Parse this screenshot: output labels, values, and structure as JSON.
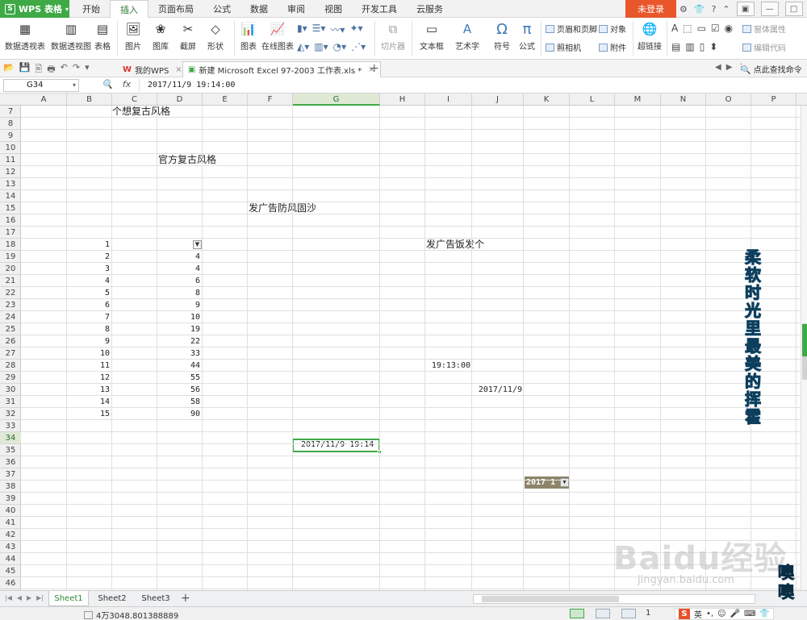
{
  "app": {
    "name": "WPS 表格",
    "login": "未登录"
  },
  "menu_tabs": [
    "开始",
    "插入",
    "页面布局",
    "公式",
    "数据",
    "审阅",
    "视图",
    "开发工具",
    "云服务"
  ],
  "active_menu_tab": "插入",
  "ribbon": {
    "pivot_table": "数据透视表",
    "pivot_chart": "数据透视图",
    "table": "表格",
    "picture": "图片",
    "gallery": "图库",
    "screenshot": "截屏",
    "shapes": "形状",
    "chart": "图表",
    "online_chart": "在线图表",
    "slicer": "切片器",
    "textbox": "文本框",
    "wordart": "艺术字",
    "symbol": "符号",
    "formula": "公式",
    "header_footer": "页眉和页脚",
    "object": "对象",
    "camera": "照相机",
    "attachment": "附件",
    "hyperlink": "超链接",
    "form_props": "窗体属性",
    "edit_code": "编辑代码"
  },
  "doc_tabs": [
    {
      "label": "我的WPS"
    },
    {
      "label": "新建 Microsoft Excel 97-2003 工作表.xls *"
    }
  ],
  "find_command": "点此查找命令",
  "name_box": "G34",
  "formula_bar": "2017/11/9  19:14:00",
  "columns": [
    "A",
    "B",
    "C",
    "D",
    "E",
    "F",
    "G",
    "H",
    "I",
    "J",
    "K",
    "L",
    "M",
    "N",
    "O",
    "P"
  ],
  "selected_column": "G",
  "rows": [
    "7",
    "8",
    "9",
    "10",
    "11",
    "12",
    "13",
    "14",
    "15",
    "16",
    "17",
    "18",
    "19",
    "20",
    "21",
    "22",
    "23",
    "24",
    "25",
    "26",
    "27",
    "28",
    "29",
    "30",
    "31",
    "32",
    "33",
    "34",
    "35",
    "36",
    "37",
    "38",
    "39",
    "40",
    "41",
    "42",
    "43",
    "44",
    "45",
    "46",
    "47"
  ],
  "selected_row": "34",
  "cells": {
    "c7": "个想复古风格",
    "d11": "官方复古风格",
    "f15": "发广告防风固沙",
    "i18": "发广告饭发个",
    "i28": "19:13:00",
    "j30": "2017/11/9",
    "g34": "2017/11/9 19:14",
    "k37": "2017 1",
    "b_values": [
      "1",
      "2",
      "3",
      "4",
      "5",
      "6",
      "7",
      "8",
      "9",
      "10",
      "11",
      "12",
      "13",
      "14",
      "15"
    ],
    "d_values": [
      "4",
      "4",
      "6",
      "8",
      "9",
      "10",
      "19",
      "22",
      "33",
      "44",
      "55",
      "56",
      "58",
      "90"
    ]
  },
  "vertical_art_text": "柔软时光里最美的挥霍",
  "sheets": [
    "Sheet1",
    "Sheet2",
    "Sheet3"
  ],
  "active_sheet": "Sheet1",
  "status": {
    "text": "4万3048.801388889",
    "zoom": "1"
  },
  "ime": {
    "lang": "英"
  },
  "watermark": {
    "brand": "Baidu经验",
    "url": "jingyan.baidu.com",
    "stamp": "噢噢"
  }
}
